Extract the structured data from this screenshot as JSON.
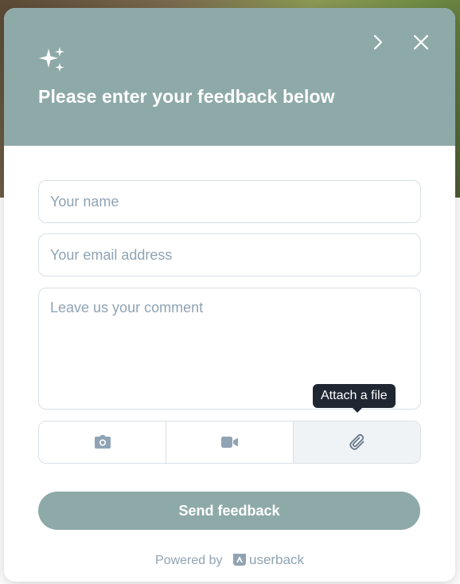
{
  "header": {
    "title": "Please enter your feedback below",
    "icons": {
      "sparkle": "sparkles-icon",
      "next": "chevron-right-icon",
      "close": "close-icon"
    }
  },
  "form": {
    "name_placeholder": "Your name",
    "email_placeholder": "Your email address",
    "comment_placeholder": "Leave us your comment"
  },
  "attachments": {
    "tooltip": "Attach a file",
    "tools": [
      "camera-icon",
      "video-icon",
      "paperclip-icon"
    ]
  },
  "send_label": "Send feedback",
  "footer": {
    "powered_by": "Powered by",
    "brand": "userback"
  },
  "colors": {
    "accent": "#8eaaa8",
    "tooltip_bg": "#1f2733",
    "icon": "#8fa3b4"
  }
}
